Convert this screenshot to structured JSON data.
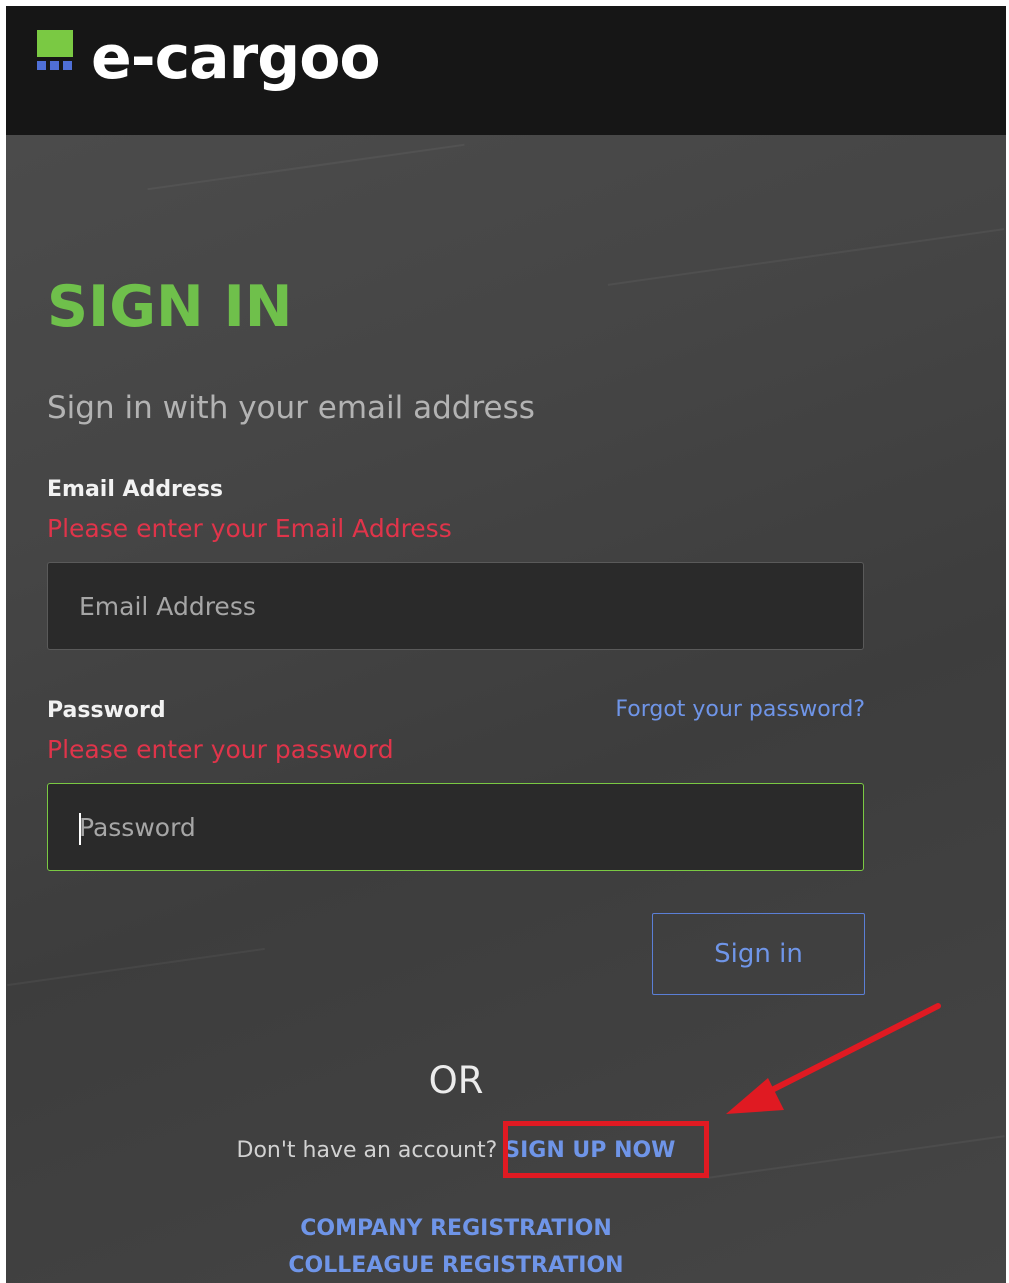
{
  "brand": {
    "name": "e-cargoo",
    "colors": {
      "green": "#7ac943",
      "blue": "#4f6fd6"
    }
  },
  "signin": {
    "title": "SIGN IN",
    "subtitle": "Sign in with your email address",
    "email": {
      "label": "Email Address",
      "error": "Please enter your Email Address",
      "placeholder": "Email Address",
      "value": ""
    },
    "password": {
      "label": "Password",
      "error": "Please enter your password",
      "placeholder": "Password",
      "value": "",
      "forgot_link": "Forgot your password?"
    },
    "submit_label": "Sign in"
  },
  "alternatives": {
    "or_text": "OR",
    "no_account_text": "Don't have an account?",
    "signup_link": "SIGN UP NOW",
    "company_registration": "COMPANY REGISTRATION",
    "colleague_registration": "COLLEAGUE REGISTRATION"
  },
  "annotation": {
    "highlight_color": "#e01a22"
  }
}
